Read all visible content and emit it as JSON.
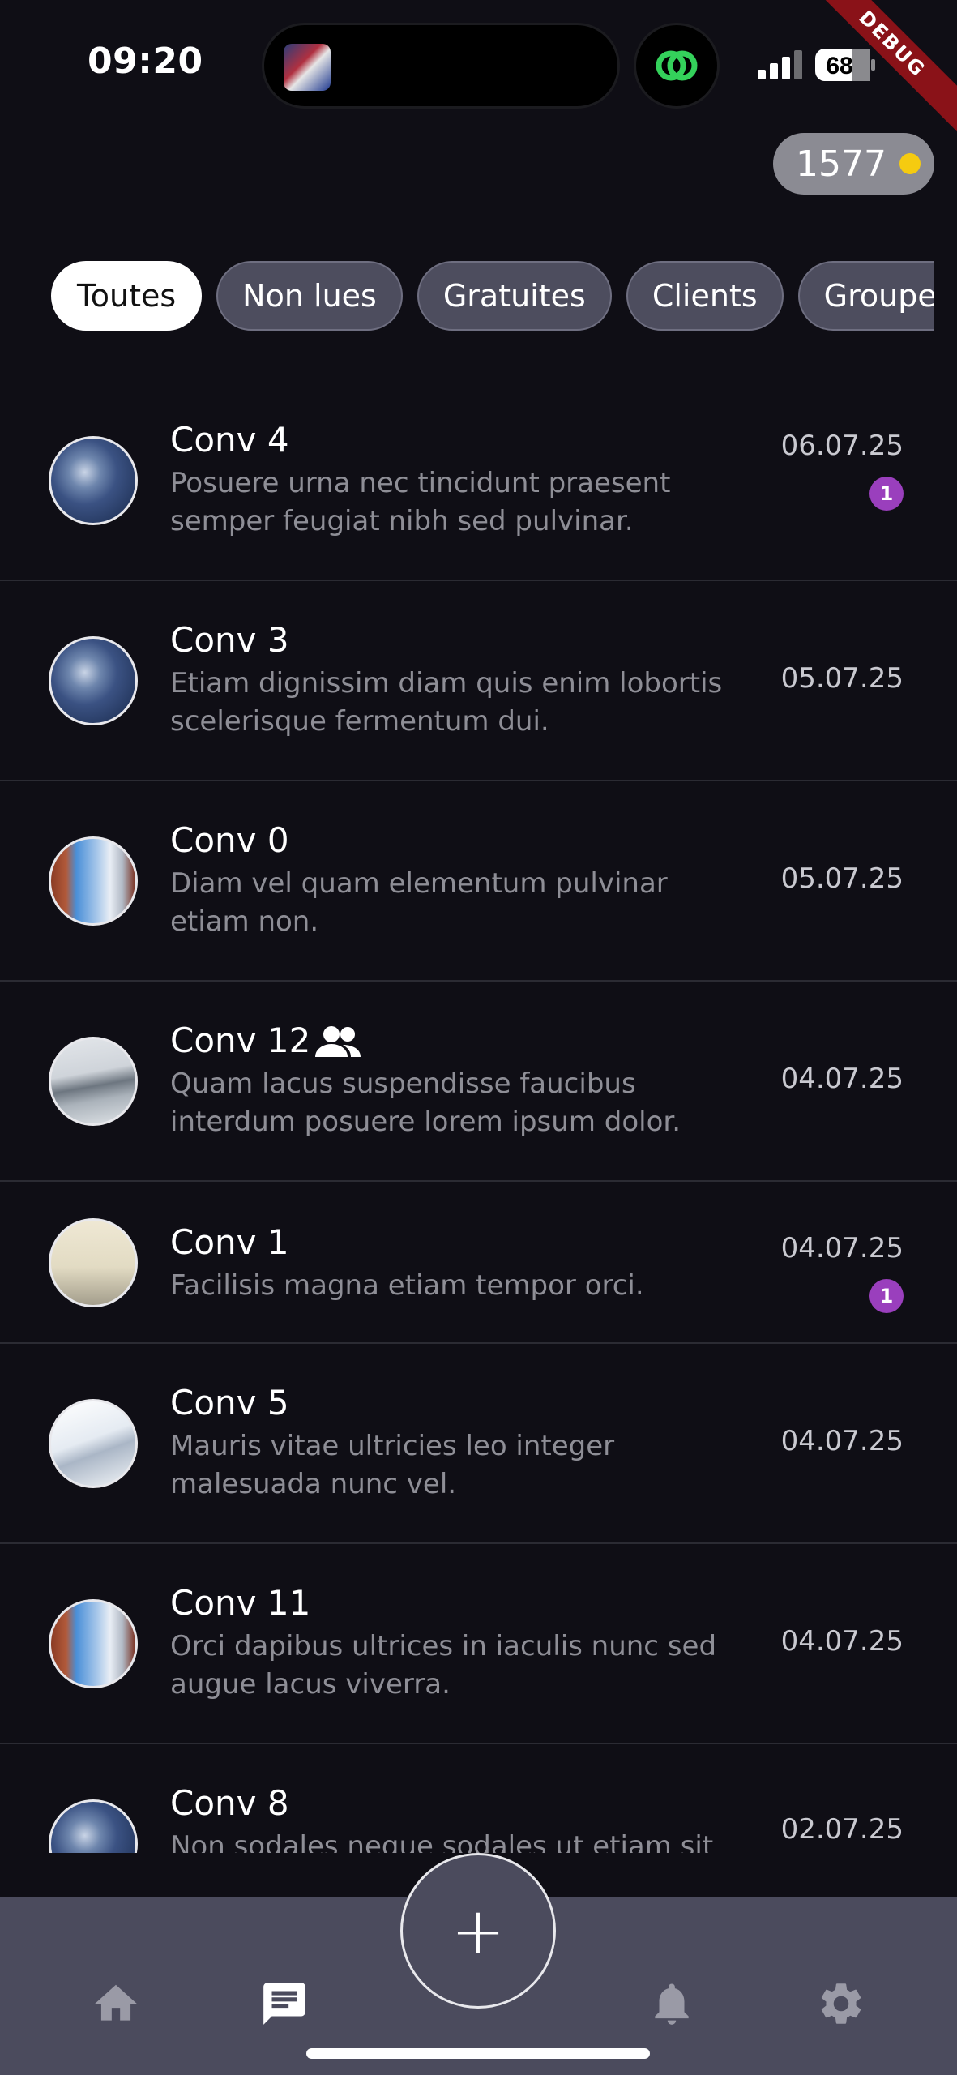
{
  "status_bar": {
    "time": "09:20",
    "battery": "68",
    "debug_label": "DEBUG"
  },
  "coins": {
    "value": "1577"
  },
  "filters": [
    {
      "label": "Toutes",
      "active": true
    },
    {
      "label": "Non lues",
      "active": false
    },
    {
      "label": "Gratuites",
      "active": false
    },
    {
      "label": "Clients",
      "active": false
    },
    {
      "label": "Groupes",
      "active": false
    }
  ],
  "conversations": [
    {
      "name": "Conv 4",
      "preview": "Posuere urna nec tincidunt praesent semper feugiat nibh sed pulvinar.",
      "date": "06.07.25",
      "unread": "1",
      "avatar": "sky-clouds",
      "group": false
    },
    {
      "name": "Conv 3",
      "preview": "Etiam dignissim diam quis enim lobortis scelerisque fermentum dui.",
      "date": "05.07.25",
      "unread": "",
      "avatar": "sky-clouds",
      "group": false
    },
    {
      "name": "Conv 0",
      "preview": "Diam vel quam elementum pulvinar etiam non.",
      "date": "05.07.25",
      "unread": "",
      "avatar": "bridge",
      "group": false
    },
    {
      "name": "Conv 12",
      "preview": "Quam lacus suspendisse faucibus interdum posuere lorem ipsum dolor.",
      "date": "04.07.25",
      "unread": "",
      "avatar": "grey-bridge",
      "group": true
    },
    {
      "name": "Conv 1",
      "preview": "Facilisis magna etiam tempor orci.",
      "date": "04.07.25",
      "unread": "1",
      "avatar": "fog",
      "group": false
    },
    {
      "name": "Conv 5",
      "preview": "Mauris vitae ultricies leo integer malesuada nunc vel.",
      "date": "04.07.25",
      "unread": "",
      "avatar": "snow",
      "group": false
    },
    {
      "name": "Conv 11",
      "preview": "Orci dapibus ultrices in iaculis nunc sed augue lacus viverra.",
      "date": "04.07.25",
      "unread": "",
      "avatar": "bridge",
      "group": false
    },
    {
      "name": "Conv 8",
      "preview": "Non sodales neque sodales ut etiam sit",
      "date": "02.07.25",
      "unread": "",
      "avatar": "sky-clouds",
      "group": false
    }
  ],
  "bottom_nav": {
    "items": [
      {
        "icon": "home-icon",
        "active": false
      },
      {
        "icon": "chat-icon",
        "active": true
      },
      {
        "icon": "bell-icon",
        "active": false
      },
      {
        "icon": "gear-icon",
        "active": false
      }
    ],
    "fab_label": "+"
  }
}
